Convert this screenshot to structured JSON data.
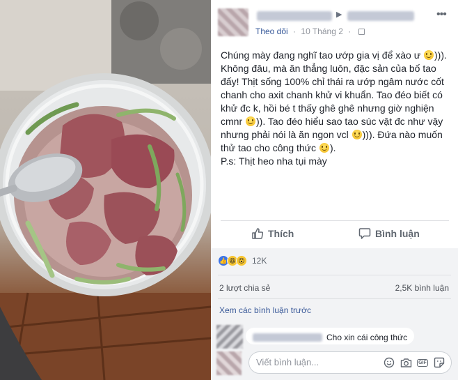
{
  "post": {
    "follow_label": "Theo dõi",
    "date": "10 Tháng 2",
    "text_lines": [
      [
        "Chúng mày đang nghĩ tao ướp gia vị để xào ư ",
        ":)",
        ")))."
      ],
      [
        "Không đâu, mà ăn thẳng luôn, đặc sản của bố tao",
        "",
        ""
      ],
      [
        "đấy! Thịt sống 100% chỉ thái ra ướp ngâm nước cốt",
        "",
        ""
      ],
      [
        "chanh cho axit chanh khử vi khuẩn. Tao đéo biết có",
        "",
        ""
      ],
      [
        "khử đc k, hồi bé t thấy ghê ghê nhưng giờ nghiện",
        "",
        ""
      ],
      [
        "cmnr ",
        ":)",
        ")). Tao đéo hiểu sao tao súc vật đc như vậy"
      ],
      [
        "nhưng phải nói là ăn ngon vcl ",
        ":)",
        "))). Đứa nào muốn"
      ],
      [
        "thử tao cho công thức ",
        ":)",
        ")."
      ],
      [
        "P.s: Thịt heo nha tụi mày",
        "",
        ""
      ]
    ]
  },
  "actions": {
    "like_label": "Thích",
    "comment_label": "Bình luận"
  },
  "stats": {
    "reaction_count": "12K",
    "shares": "2 lượt chia sẻ",
    "comments": "2,5K bình luận",
    "view_previous": "Xem các bình luận trước"
  },
  "comment": {
    "text": "Cho xin cái công thức"
  },
  "composer": {
    "placeholder": "Viết bình luận..."
  },
  "icons": {
    "more": "more-dots-icon",
    "like": "thumbs-up-icon",
    "comment": "speech-bubble-icon",
    "emoji": "emoji-icon",
    "camera": "camera-icon",
    "gif": "GIF",
    "sticker": "sticker-icon"
  },
  "colors": {
    "link": "#365899",
    "meta": "#90949c",
    "like_blue": "#3b73e8",
    "lower_bg": "#f2f3f5"
  }
}
